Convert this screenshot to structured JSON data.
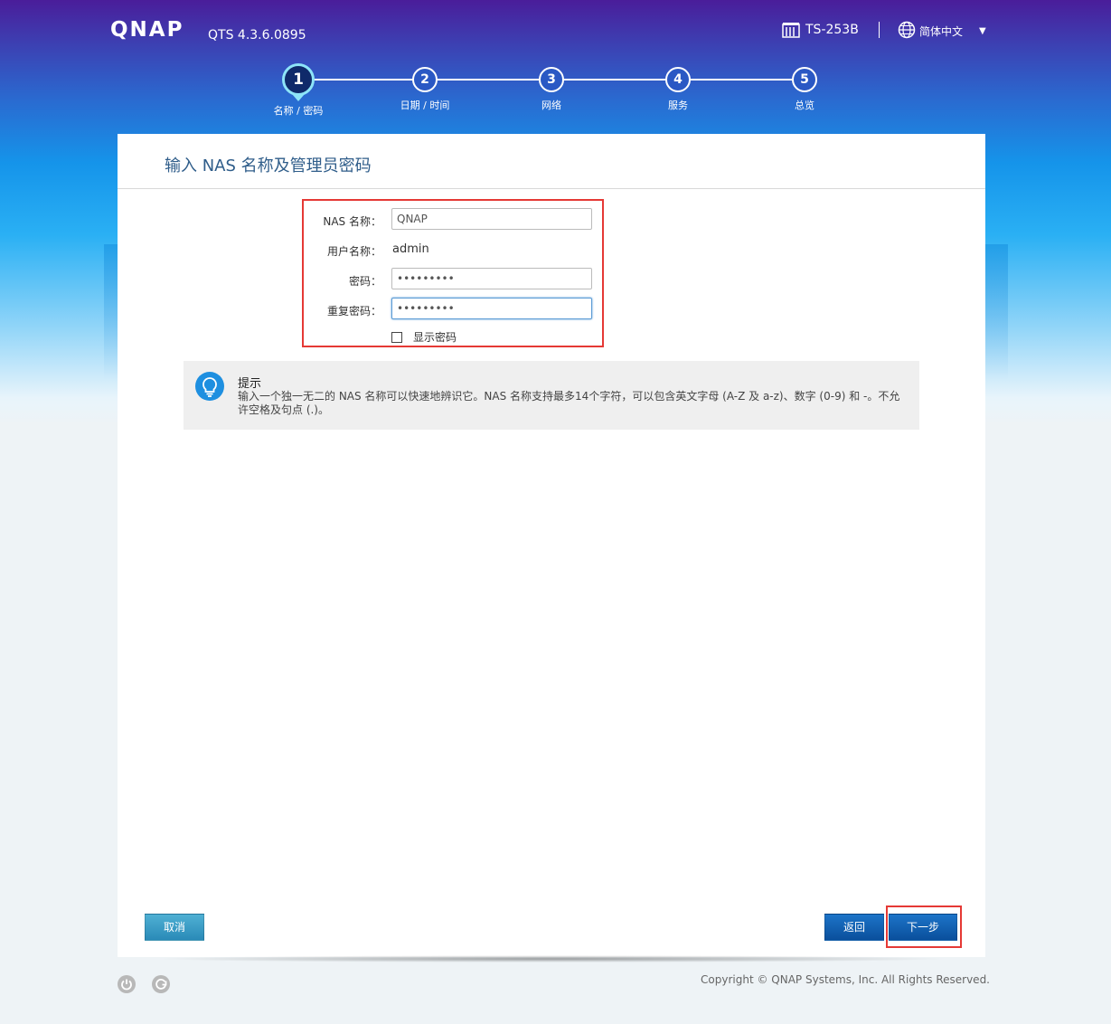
{
  "header": {
    "logo": "QNAP",
    "version": "QTS 4.3.6.0895",
    "model": "TS-253B",
    "language": "简体中文"
  },
  "steps": [
    {
      "num": "1",
      "label": "名称 / 密码",
      "active": true
    },
    {
      "num": "2",
      "label": "日期 / 时间",
      "active": false
    },
    {
      "num": "3",
      "label": "网络",
      "active": false
    },
    {
      "num": "4",
      "label": "服务",
      "active": false
    },
    {
      "num": "5",
      "label": "总览",
      "active": false
    }
  ],
  "panel": {
    "title": "输入 NAS 名称及管理员密码"
  },
  "form": {
    "nas_name_label": "NAS 名称：",
    "nas_name_value": "QNAP",
    "username_label": "用户名称：",
    "username_value": "admin",
    "password_label": "密码：",
    "password_value": "•••••••••",
    "confirm_label": "重复密码：",
    "confirm_value": "•••••••••",
    "show_password_label": "显示密码"
  },
  "tip": {
    "title": "提示",
    "text": "输入一个独一无二的 NAS 名称可以快速地辨识它。NAS 名称支持最多14个字符，可以包含英文字母 (A-Z 及 a-z)、数字 (0-9) 和 -。不允许空格及句点 (.)。"
  },
  "buttons": {
    "cancel": "取消",
    "back": "返回",
    "next": "下一步"
  },
  "footer": {
    "copyright": "Copyright © QNAP Systems, Inc. All Rights Reserved."
  }
}
